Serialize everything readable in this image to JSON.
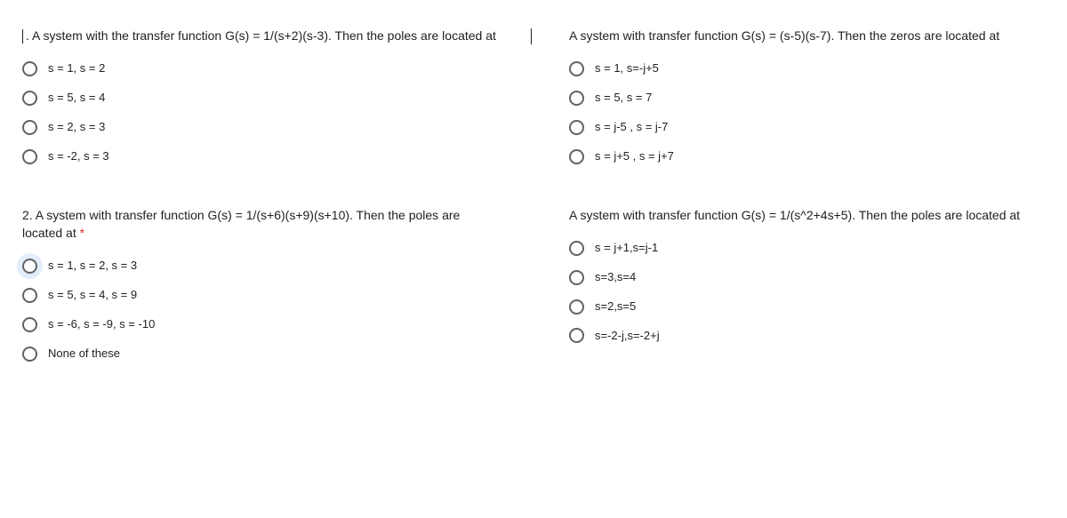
{
  "left": {
    "q1": {
      "prompt": ". A system with the transfer function G(s) = 1/(s+2)(s-3). Then the poles are located at",
      "options": [
        "s = 1, s = 2",
        "s = 5, s = 4",
        "s = 2, s = 3",
        "s = -2, s = 3"
      ]
    },
    "q2": {
      "prompt": "2. A system with transfer function G(s) = 1/(s+6)(s+9)(s+10). Then the poles are located at ",
      "required_mark": "*",
      "options": [
        "s = 1, s = 2, s = 3",
        "s = 5, s = 4, s = 9",
        "s = -6, s = -9, s = -10",
        "None of these"
      ]
    }
  },
  "right": {
    "q3": {
      "prompt": "A system with transfer function G(s) = (s-5)(s-7). Then the zeros are located at",
      "options": [
        "s = 1, s=-j+5",
        "s = 5, s = 7",
        "s = j-5 , s = j-7",
        "s = j+5 , s = j+7"
      ]
    },
    "q4": {
      "prompt": "A system with transfer function G(s) = 1/(s^2+4s+5). Then the poles are located at",
      "options": [
        "s = j+1,s=j-1",
        "s=3,s=4",
        "s=2,s=5",
        "s=-2-j,s=-2+j"
      ]
    }
  }
}
